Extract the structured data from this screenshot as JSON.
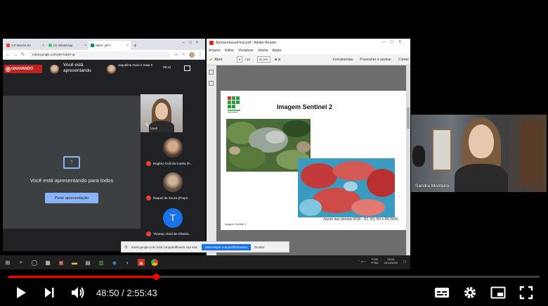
{
  "chrome": {
    "tabs": [
      {
        "label": "14ª Mostra de",
        "icon": "gmail-icon",
        "color": "#ea4335"
      },
      {
        "label": "(2) WhatsApp",
        "icon": "whatsapp-icon",
        "color": "#25d366"
      },
      {
        "label": "Meet: yth-f",
        "icon": "meet-icon",
        "color": "#00897b"
      }
    ],
    "url": "meet.google.com/yth-fcddm-qr"
  },
  "meet": {
    "rec_badge": "GRAVANDO",
    "presenting_status": "Você está apresentando",
    "joined_notice": "Jaqueline Alvisi e mais 6",
    "time": "09:12",
    "self_label": "Você",
    "presenting_to_all": "Você está apresentando para todos",
    "stop_button": "Parar apresentação",
    "participants": [
      {
        "name": "Rogério Colli da Cunha (P...",
        "avatar": "photo"
      },
      {
        "name": "Raquel de Souza (Porpo...",
        "avatar": "photo"
      },
      {
        "name": "Thomaz Alvisi de Oliveira...",
        "avatar": "letter",
        "initial": "T"
      }
    ]
  },
  "reader": {
    "title": "ApresentacaoFinal.pdf - Adobe Reader",
    "menu": [
      "Arquivo",
      "Editar",
      "Visualizar",
      "Janela",
      "Ajuda"
    ],
    "open_label": "Abrir",
    "page": "6",
    "page_total": "/ 23",
    "zoom": "31,8%",
    "tools": "Ferramentas",
    "fill_sign": "Preencher e assinar",
    "comment": "Comentário"
  },
  "slide": {
    "title": "Imagem Sentinel 2",
    "caption": "Ajuste das bandas RGB - B2, B3, B4 e B8 (NIR)",
    "footer": "Imagem: Sentinel 2"
  },
  "cam": {
    "name": "Sandra Monteiro"
  },
  "notification": {
    "text": "meet.google.com está compartilhando sua tela.",
    "share_button": "Interromper compartilhamento",
    "hide_button": "Ocultar"
  },
  "taskbar": {
    "lang": "POR",
    "layout": "PTB2",
    "clock": "09:54",
    "date": "20/11/2020"
  },
  "player": {
    "current_time": "48:50",
    "duration": "2:55:43",
    "progress_fraction": 0.278,
    "accent": "#ff0000"
  }
}
